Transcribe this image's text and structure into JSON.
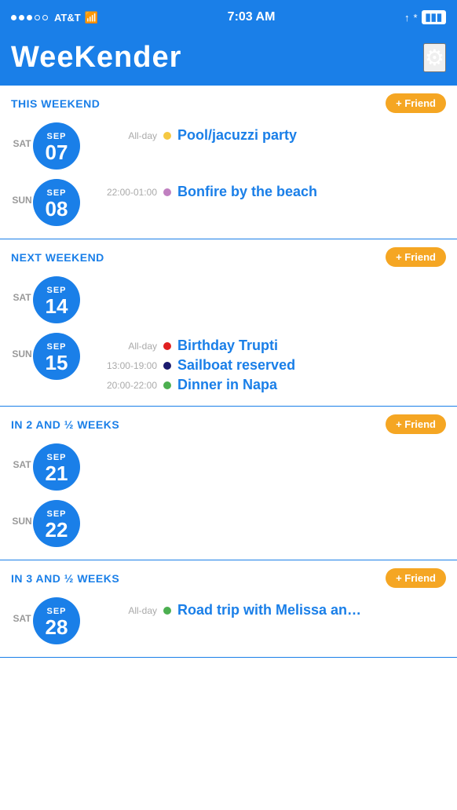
{
  "status_bar": {
    "dots": [
      "filled",
      "filled",
      "filled",
      "empty",
      "empty"
    ],
    "carrier": "AT&T",
    "wifi": "📶",
    "time": "7:03 AM",
    "battery": "🔋"
  },
  "header": {
    "title": "WeeKender",
    "gear_label": "⚙"
  },
  "sections": [
    {
      "id": "this-weekend",
      "title": "THIS WEEKEND",
      "add_friend_label": "+ Friend",
      "days": [
        {
          "day_label": "SAT",
          "month": "SEP",
          "date": "07",
          "events": [
            {
              "time": "All-day",
              "dot_class": "dot-yellow",
              "title": "Pool/jacuzzi  party"
            }
          ]
        },
        {
          "day_label": "SUN",
          "month": "SEP",
          "date": "08",
          "events": [
            {
              "time": "22:00-01:00",
              "dot_class": "dot-purple",
              "title": "Bonfire by the beach"
            }
          ]
        }
      ]
    },
    {
      "id": "next-weekend",
      "title": "NEXT WEEKEND",
      "add_friend_label": "+ Friend",
      "days": [
        {
          "day_label": "SAT",
          "month": "SEP",
          "date": "14",
          "events": []
        },
        {
          "day_label": "SUN",
          "month": "SEP",
          "date": "15",
          "events": [
            {
              "time": "All-day",
              "dot_class": "dot-red",
              "title": "Birthday Trupti"
            },
            {
              "time": "13:00-19:00",
              "dot_class": "dot-navy",
              "title": "Sailboat reserved"
            },
            {
              "time": "20:00-22:00",
              "dot_class": "dot-green",
              "title": "Dinner in Napa"
            }
          ]
        }
      ]
    },
    {
      "id": "in-2-half-weeks",
      "title": "IN 2 AND ½ WEEKS",
      "add_friend_label": "+ Friend",
      "days": [
        {
          "day_label": "SAT",
          "month": "SEP",
          "date": "21",
          "events": []
        },
        {
          "day_label": "SUN",
          "month": "SEP",
          "date": "22",
          "events": []
        }
      ]
    },
    {
      "id": "in-3-half-weeks",
      "title": "IN 3 AND ½ WEEKS",
      "add_friend_label": "+ Friend",
      "days": [
        {
          "day_label": "SAT",
          "month": "SEP",
          "date": "28",
          "events": [
            {
              "time": "All-day",
              "dot_class": "dot-green2",
              "title": "Road trip with Melissa an…"
            }
          ]
        }
      ]
    }
  ]
}
